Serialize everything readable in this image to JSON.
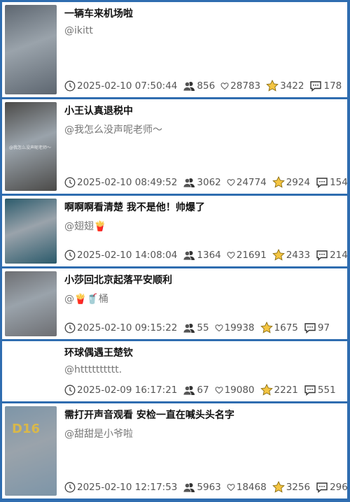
{
  "posts": [
    {
      "title": "一辆车来机场啦",
      "author": "@ikitt",
      "date": "2025-02-10 07:50:44",
      "views": "856",
      "likes": "28783",
      "favorites": "3422",
      "comments": "178",
      "thumb_overlay": "",
      "thumb_label": "",
      "height": 136,
      "thumb": "#5d6670"
    },
    {
      "title": "小王认真退税中",
      "author": "@我怎么没声呢老师～",
      "date": "2025-02-10 08:49:52",
      "views": "3062",
      "likes": "24774",
      "favorites": "2924",
      "comments": "154",
      "thumb_overlay": "@我怎么没声呢老师～",
      "thumb_label": "",
      "height": 135,
      "thumb": "#4b4a48"
    },
    {
      "title": "啊啊啊看清楚 我不是他！帅爆了",
      "author": "@翅翅🍟",
      "date": "2025-02-10 14:08:04",
      "views": "1364",
      "likes": "21691",
      "favorites": "2433",
      "comments": "214",
      "thumb_overlay": "",
      "thumb_label": "",
      "height": 101,
      "thumb": "#2b5a6b"
    },
    {
      "title": "小莎回北京起落平安顺利",
      "author": "@🍟🥤桶",
      "date": "2025-02-10 09:15:22",
      "views": "55",
      "likes": "19938",
      "favorites": "1675",
      "comments": "97",
      "thumb_overlay": "",
      "thumb_label": "",
      "height": 101,
      "thumb": "#6d6e72"
    },
    {
      "title": "环球偶遇王楚钦",
      "author": "@htttttttttt.",
      "date": "2025-02-09 16:17:21",
      "views": "67",
      "likes": "19080",
      "favorites": "2221",
      "comments": "551",
      "thumb_overlay": "",
      "thumb_label": "",
      "height": 86,
      "thumb": "#ffffff"
    },
    {
      "title": "需打开声音观看 安检一直在喊头头名字",
      "author": "@甜甜是小爷啦",
      "date": "2025-02-10 12:17:53",
      "views": "5963",
      "likes": "18468",
      "favorites": "3256",
      "comments": "296",
      "thumb_overlay": "",
      "thumb_label": "D16",
      "height": 136,
      "thumb": "#7d95a8"
    }
  ],
  "icons": {
    "time": "clock-icon",
    "views": "people-icon",
    "likes": "heart-icon",
    "favorites": "star-icon",
    "comments": "comment-icon"
  },
  "colors": {
    "background": "#2f6db0",
    "star": "#f4c542",
    "text": "#111111",
    "meta": "#555555"
  }
}
